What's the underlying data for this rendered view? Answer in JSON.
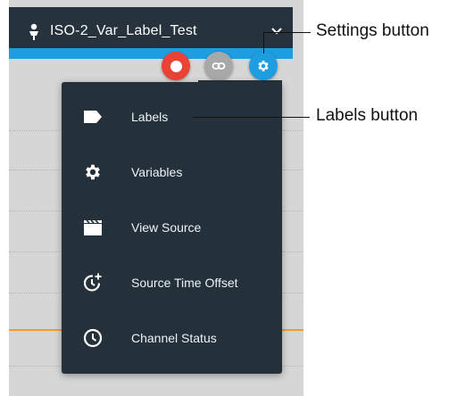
{
  "header": {
    "title": "ISO-2_Var_Label_Test"
  },
  "fabs": {
    "record_icon": "record-dot",
    "link_icon": "link-icon",
    "settings_icon": "gear-icon"
  },
  "menu": {
    "items": [
      {
        "label": "Labels",
        "icon": "label-tag-icon"
      },
      {
        "label": "Variables",
        "icon": "gear-icon"
      },
      {
        "label": "View Source",
        "icon": "clapperboard-icon"
      },
      {
        "label": "Source Time Offset",
        "icon": "clock-plus-icon"
      },
      {
        "label": "Channel Status",
        "icon": "clock-icon"
      }
    ]
  },
  "callouts": {
    "settings": "Settings button",
    "labels": "Labels button"
  },
  "colors": {
    "header_bg": "#26323c",
    "accent_blue": "#1e9ee1",
    "record_red": "#ea4335",
    "menu_bg": "#24313b",
    "orange_line": "#f39c26"
  }
}
